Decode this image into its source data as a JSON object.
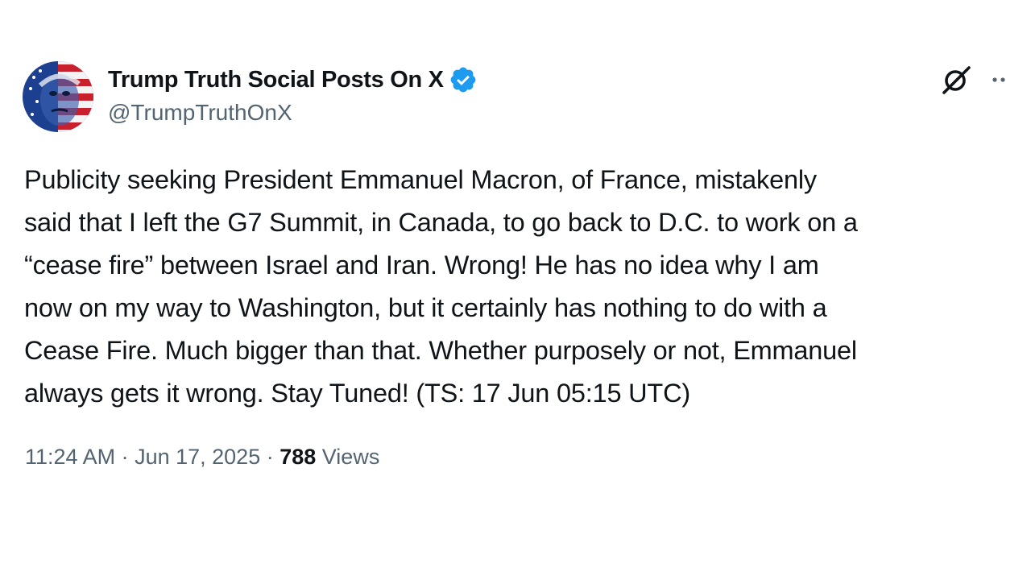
{
  "post": {
    "author": {
      "display_name": "Trump Truth Social Posts On X",
      "handle": "@TrumpTruthOnX",
      "verified": true,
      "verified_color": "#1d9bf0",
      "avatar_icon": "flag-portrait-avatar"
    },
    "text": "Publicity seeking President Emmanuel Macron, of France, mistakenly\nsaid that I left the G7 Summit, in Canada, to go back to D.C. to work on a\n“cease fire” between Israel and Iran. Wrong! He has no idea why I am\nnow on my way to Washington, but it certainly has nothing to do with a\nCease Fire. Much bigger than that. Whether purposely or not, Emmanuel\nalways gets it wrong. Stay Tuned! (TS: 17 Jun 05:15 UTC)",
    "time": "11:24 AM",
    "separator": " · ",
    "date": "Jun 17, 2025",
    "views_count": "788",
    "views_label": " Views"
  },
  "actions": {
    "grok_icon": "grok-icon",
    "more_icon": "more-icon"
  },
  "colors": {
    "text_primary": "#0f1419",
    "text_secondary": "#536471",
    "background": "#ffffff"
  }
}
